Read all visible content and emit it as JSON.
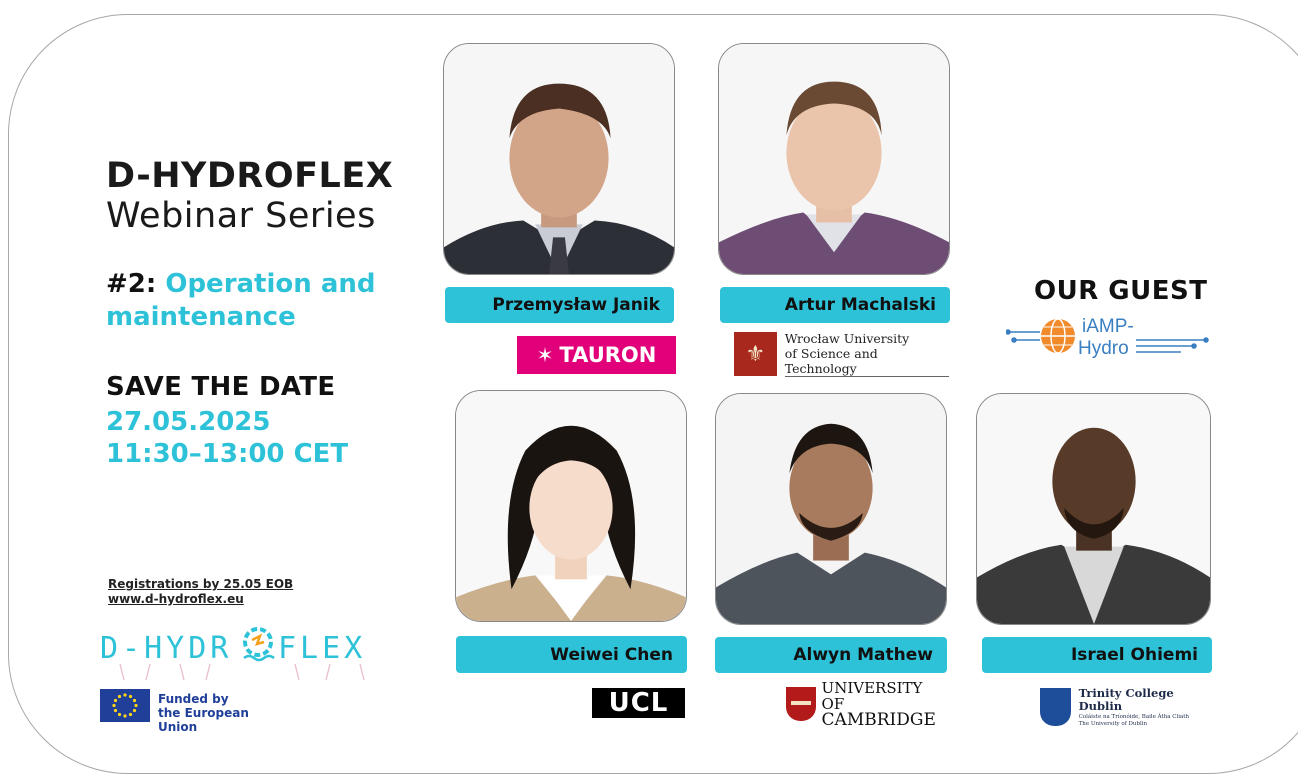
{
  "title": {
    "line1": "D-HYDROFLEX",
    "line2": "Webinar Series"
  },
  "topic": {
    "number": "#2",
    "text": "Operation and maintenance"
  },
  "save_the_date": {
    "label": "SAVE THE DATE",
    "date": "27.05.2025",
    "time": "11:30–13:00 CET"
  },
  "registration": {
    "line1": "Registrations by 25.05 EOB",
    "line2": "www.d-hydroflex.eu"
  },
  "project_logo": {
    "text_left": "D-HYDR",
    "text_right": "FLEX"
  },
  "eu": {
    "line1": "Funded by",
    "line2": "the European Union"
  },
  "guest": {
    "label": "OUR GUEST",
    "logo_text1": "iAMP-",
    "logo_text2": "Hydro"
  },
  "speakers": [
    {
      "name": "Przemysław Janik",
      "org": "TAURON"
    },
    {
      "name": "Artur Machalski",
      "org_line1": "Wrocław University",
      "org_line2": "of Science and Technology"
    },
    {
      "name": "Weiwei Chen",
      "org": "UCL"
    },
    {
      "name": "Alwyn Mathew",
      "org_line1": "UNIVERSITY OF",
      "org_line2": "CAMBRIDGE"
    },
    {
      "name": "Israel Ohiemi",
      "org_line1": "Trinity College Dublin",
      "org_line2": "Coláiste na Tríonóide, Baile Átha Cliath",
      "org_line3": "The University of Dublin"
    }
  ],
  "colors": {
    "accent": "#2ec2d8",
    "tauron": "#e2007a",
    "eu_blue": "#1f3f99"
  }
}
